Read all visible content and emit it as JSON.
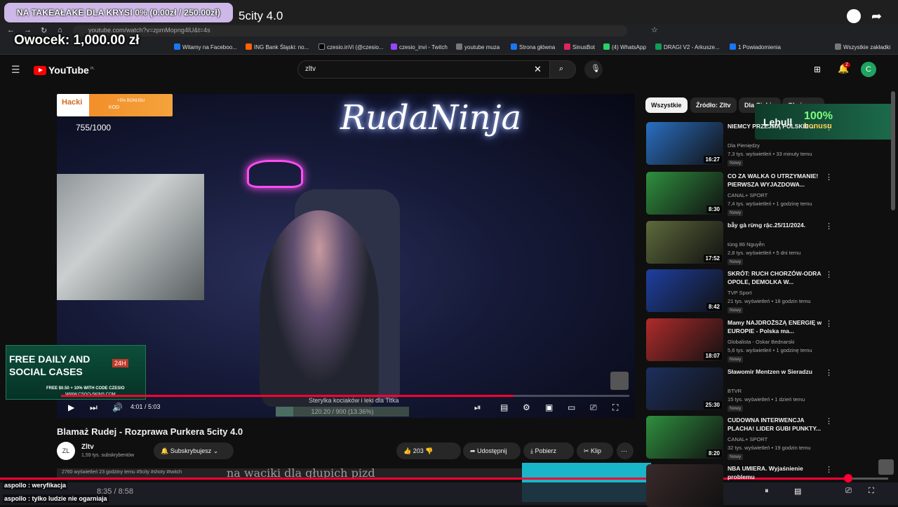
{
  "browser": {
    "tab_title": "5city 4.0",
    "url": "youtube.com/watch?v=zpmMopng4lU&t=4s",
    "bookmarks": [
      "Witamy na Faceboo...",
      "ING Bank Śląski: no...",
      "czesio.inVi (@czesio...",
      "czesio_invi - Twitch",
      "youtube muza",
      "Strona główna",
      "SinusBot",
      "(4) WhatsApp",
      "DRAGI V2 - Arkusze...",
      "1 Powiadomienia"
    ],
    "all_bookmarks": "Wszystkie zakładki"
  },
  "stream_overlay": {
    "donation_bar": "NA TAKEAŁAKE DLA KRYSI 0% (0.00zł / 250.00zł)",
    "donor_label": "Owocek: 1,000.00 zł",
    "hakli_kod": "KOD",
    "hakli_bonus": "+5% BONUSU",
    "hakli_logo": "Hacki",
    "cases_counter": "755/1000",
    "free_daily_line1": "FREE DAILY AND",
    "free_daily_line2": "SOCIAL CASES",
    "free_daily_24h": "24H",
    "free_daily_code": "FREE $0.50 + 10% WITH CODE CZESIO",
    "free_daily_site": "WWW.CSGO-SKINS.COM",
    "subgoal_label": "Sterylka kociaków i leki dla Titka",
    "subgoal_text": "120.20 / 900 (13.36%)",
    "subgoal_fraction": 0.1336,
    "subtitle": "na waciki dla głupich pizd",
    "lebull_name": "Lebull",
    "lebull_pct": "100%",
    "lebull_bonus": "bonusu",
    "outer_time": "8:35 / 8:58",
    "outer_progress_fraction": 0.957,
    "chat": [
      {
        "user": "aspollo",
        "msg": "weryfikacja"
      },
      {
        "user": "aspollo",
        "msg": "tylko ludzie nie ogarniaja"
      }
    ]
  },
  "youtube": {
    "logo": "YouTube",
    "logo_region": "PL",
    "search_value": "zltv",
    "notification_count": "2",
    "avatar_letter": "C",
    "video": {
      "neon_sign": "RudaNinja",
      "time": "4:01 / 5:03",
      "progress_fraction": 0.796,
      "title": "Blamaż Rudej - Rozprawa Purkera 5city 4.0",
      "channel_name": "Zltv",
      "channel_subs": "1,59 tys. subskrybentów",
      "channel_avatar": "ZL",
      "subscribe_label": "Subskrybujesz",
      "likes": "203",
      "share": "Udostępnij",
      "download": "Pobierz",
      "clip": "Klip",
      "description": "2760 wyświetleń  23 godziny temu  #5city #shoty #twitch"
    },
    "chips": [
      "Wszystkie",
      "Źródło: Zltv",
      "Dla Ciebie",
      "Obejrzane"
    ],
    "recommendations": [
      {
        "title": "NIEMCY PRZEJMĄ POLSKIE ...",
        "channel": "Dla Pieniędzy",
        "meta": "7,3 tys. wyświetleń • 33 minuty temu",
        "badge": "Nowy",
        "duration": "16:27",
        "thumb": "#2a6fc2"
      },
      {
        "title": "CO ZA WALKA O UTRZYMANIE! PIERWSZA WYJAZDOWA...",
        "channel": "CANAL+ SPORT",
        "meta": "7,4 tys. wyświetleń • 1 godzinę temu",
        "badge": "Nowy",
        "duration": "8:30",
        "thumb": "#2f8f3f"
      },
      {
        "title": "bẫy gà rừng rặc.25/11/2024.",
        "channel": "tùng 86 Nguyễn",
        "meta": "2,8 tys. wyświetleń • 5 dni temu",
        "badge": "Nowy",
        "duration": "17:52",
        "thumb": "#5d6a3c"
      },
      {
        "title": "SKRÓT: RUCH CHORZÓW-ODRA OPOLE, DEMOLKA W...",
        "channel": "TVP Sport",
        "meta": "21 tys. wyświetleń • 18 godzin temu",
        "badge": "Nowy",
        "duration": "8:42",
        "thumb": "#1e3fa0"
      },
      {
        "title": "Mamy NAJDROŻSZĄ ENERGIĘ w EUROPIE - Polska ma...",
        "channel": "Globalista - Oskar Bednarski",
        "meta": "5,6 tys. wyświetleń • 1 godzinę temu",
        "badge": "Nowy",
        "duration": "18:07",
        "thumb": "#b02b2b"
      },
      {
        "title": "Sławomir Mentzen w Sieradzu",
        "channel": "BTVR",
        "meta": "15 tys. wyświetleń • 1 dzień temu",
        "badge": "Nowy",
        "duration": "25:30",
        "thumb": "#1d2f5c"
      },
      {
        "title": "CUDOWNA INTERWENCJA PLACHA! LIDER GUBI PUNKTY...",
        "channel": "CANAL+ SPORT",
        "meta": "32 tys. wyświetleń • 19 godzin temu",
        "badge": "Nowy",
        "duration": "8:20",
        "thumb": "#2f8f3f"
      },
      {
        "title": "NBA UMIERA. Wyjaśnienie problemu",
        "channel": "",
        "meta": "",
        "badge": "",
        "duration": "",
        "thumb": "#3a2a2a"
      }
    ]
  }
}
